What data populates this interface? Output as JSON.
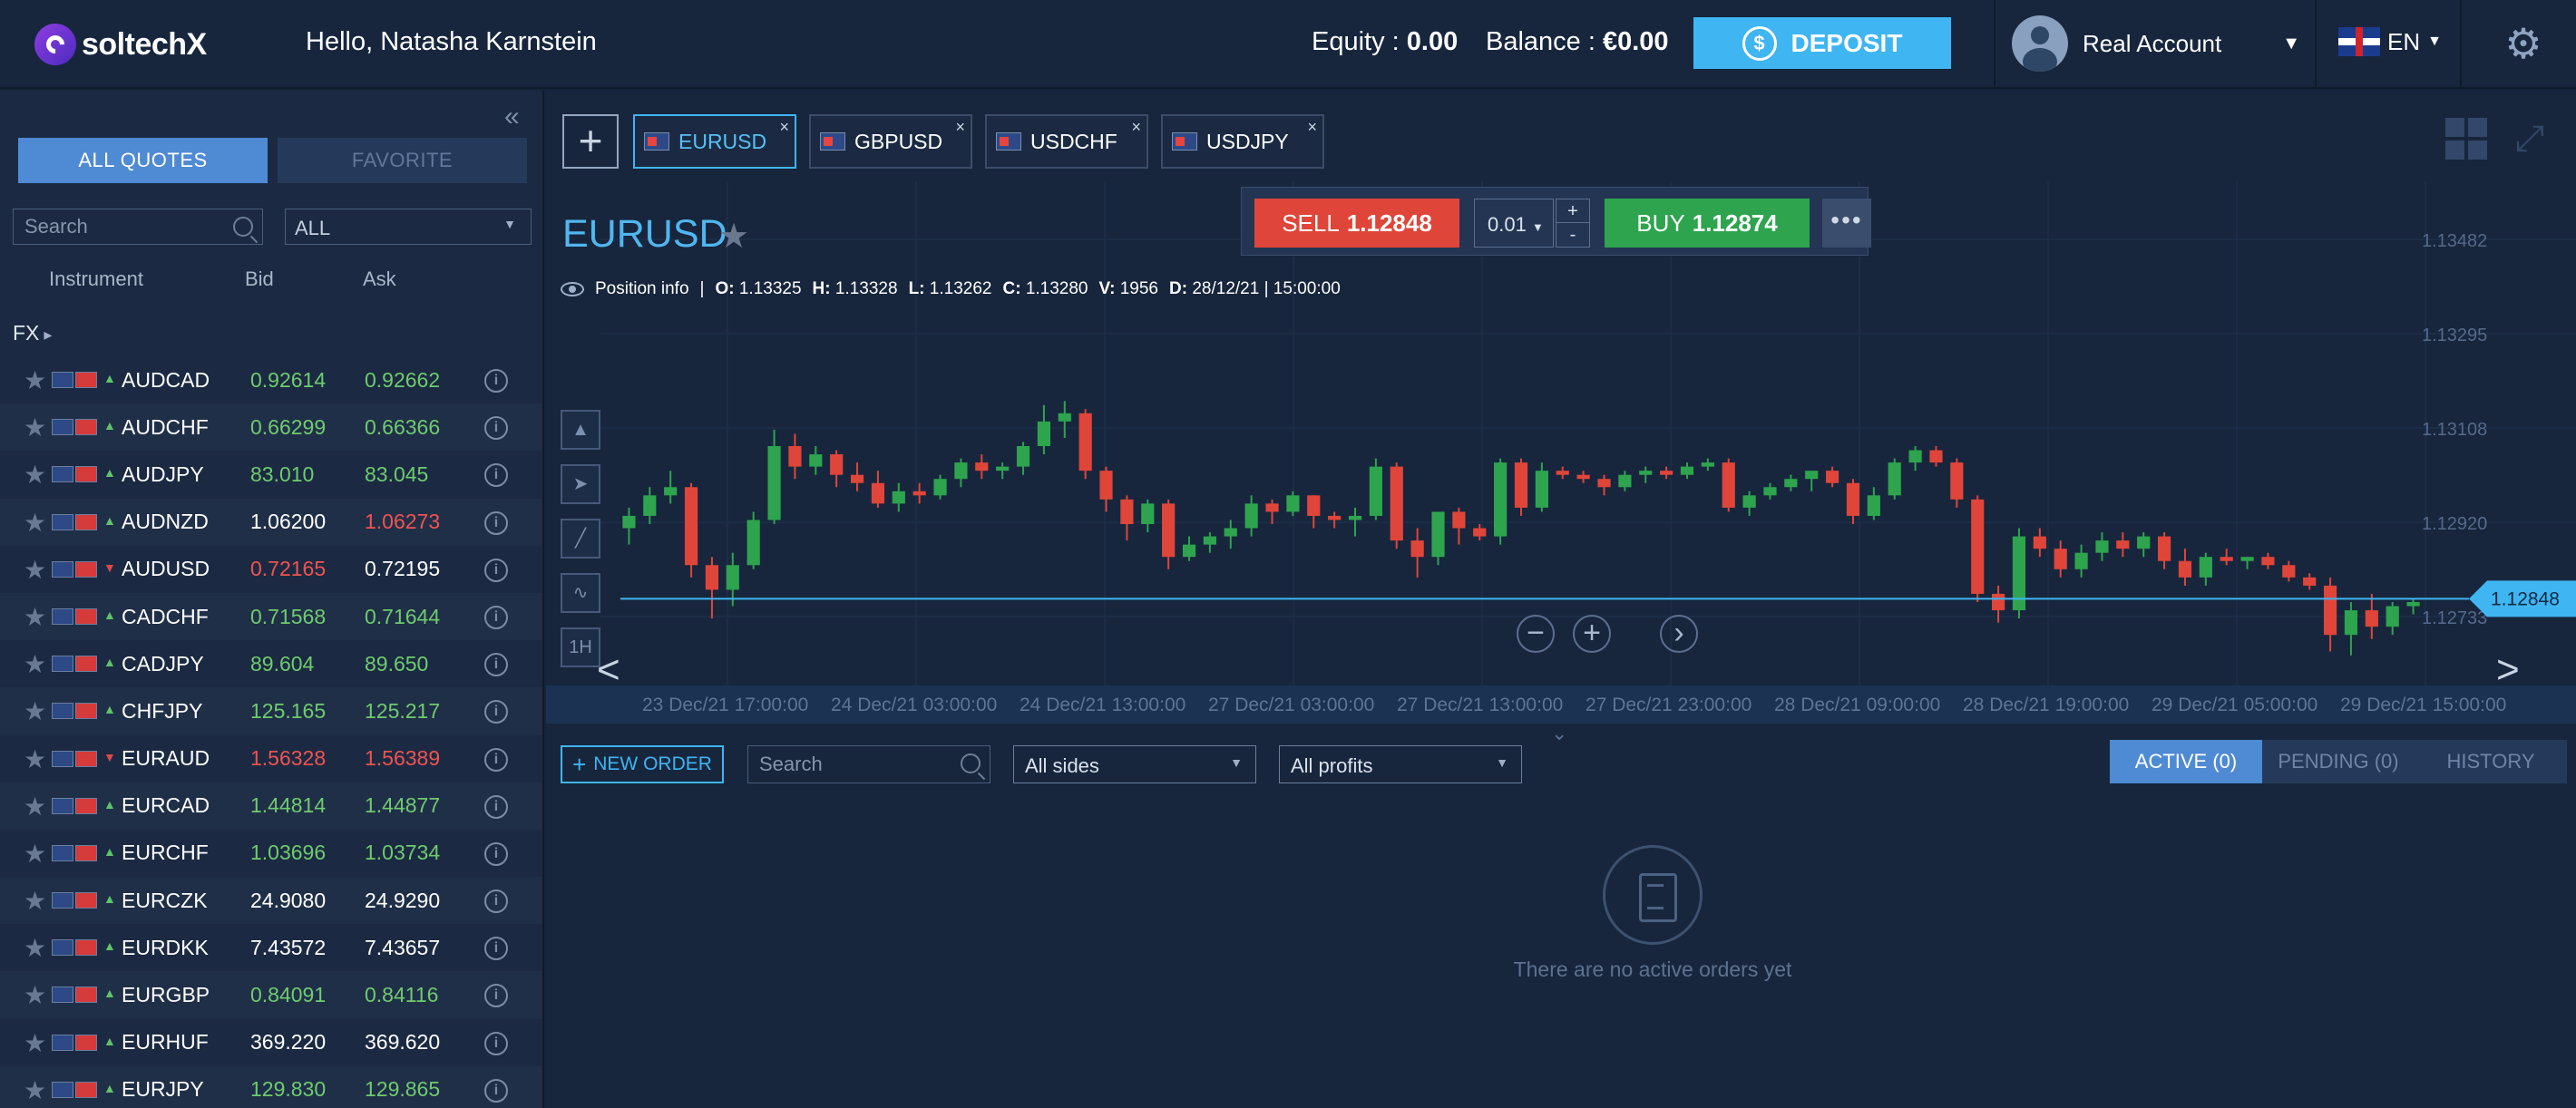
{
  "header": {
    "brand": "soltechX",
    "greeting": "Hello, Natasha Karnstein",
    "equity_label": "Equity :",
    "equity_value": "0.00",
    "balance_label": "Balance :",
    "balance_value": "€0.00",
    "deposit_label": "DEPOSIT",
    "deposit_coin": "$",
    "account_label": "Real Account",
    "language": "EN"
  },
  "sidebar": {
    "tab_all": "ALL QUOTES",
    "tab_favorite": "FAVORITE",
    "search_placeholder": "Search",
    "filter_value": "ALL",
    "col_instrument": "Instrument",
    "col_bid": "Bid",
    "col_ask": "Ask",
    "group": "FX",
    "quotes": [
      {
        "symbol": "AUDCAD",
        "bid": "0.92614",
        "ask": "0.92662",
        "dir": "up",
        "bid_color": "up",
        "ask_color": "up"
      },
      {
        "symbol": "AUDCHF",
        "bid": "0.66299",
        "ask": "0.66366",
        "dir": "up",
        "bid_color": "up",
        "ask_color": "up"
      },
      {
        "symbol": "AUDJPY",
        "bid": "83.010",
        "ask": "83.045",
        "dir": "up",
        "bid_color": "up",
        "ask_color": "up"
      },
      {
        "symbol": "AUDNZD",
        "bid": "1.06200",
        "ask": "1.06273",
        "dir": "up",
        "bid_color": "nt",
        "ask_color": "dn"
      },
      {
        "symbol": "AUDUSD",
        "bid": "0.72165",
        "ask": "0.72195",
        "dir": "down",
        "bid_color": "dn",
        "ask_color": "nt"
      },
      {
        "symbol": "CADCHF",
        "bid": "0.71568",
        "ask": "0.71644",
        "dir": "up",
        "bid_color": "up",
        "ask_color": "up"
      },
      {
        "symbol": "CADJPY",
        "bid": "89.604",
        "ask": "89.650",
        "dir": "up",
        "bid_color": "up",
        "ask_color": "up"
      },
      {
        "symbol": "CHFJPY",
        "bid": "125.165",
        "ask": "125.217",
        "dir": "up",
        "bid_color": "up",
        "ask_color": "up"
      },
      {
        "symbol": "EURAUD",
        "bid": "1.56328",
        "ask": "1.56389",
        "dir": "down",
        "bid_color": "dn",
        "ask_color": "dn"
      },
      {
        "symbol": "EURCAD",
        "bid": "1.44814",
        "ask": "1.44877",
        "dir": "up",
        "bid_color": "up",
        "ask_color": "up"
      },
      {
        "symbol": "EURCHF",
        "bid": "1.03696",
        "ask": "1.03734",
        "dir": "up",
        "bid_color": "up",
        "ask_color": "up"
      },
      {
        "symbol": "EURCZK",
        "bid": "24.9080",
        "ask": "24.9290",
        "dir": "up",
        "bid_color": "nt",
        "ask_color": "nt"
      },
      {
        "symbol": "EURDKK",
        "bid": "7.43572",
        "ask": "7.43657",
        "dir": "up",
        "bid_color": "nt",
        "ask_color": "nt"
      },
      {
        "symbol": "EURGBP",
        "bid": "0.84091",
        "ask": "0.84116",
        "dir": "up",
        "bid_color": "up",
        "ask_color": "up"
      },
      {
        "symbol": "EURHUF",
        "bid": "369.220",
        "ask": "369.620",
        "dir": "up",
        "bid_color": "nt",
        "ask_color": "nt"
      },
      {
        "symbol": "EURJPY",
        "bid": "129.830",
        "ask": "129.865",
        "dir": "up",
        "bid_color": "up",
        "ask_color": "up"
      }
    ]
  },
  "tabs": [
    {
      "label": "EURUSD",
      "active": true
    },
    {
      "label": "GBPUSD",
      "active": false
    },
    {
      "label": "USDCHF",
      "active": false
    },
    {
      "label": "USDJPY",
      "active": false
    }
  ],
  "chart": {
    "symbol": "EURUSD",
    "sell_label": "SELL",
    "sell_price": "1.12848",
    "lot": "0.01",
    "buy_label": "BUY",
    "buy_price": "1.12874",
    "position_info": "Position info",
    "ohlc": {
      "o": "1.13325",
      "h": "1.13328",
      "l": "1.13262",
      "c": "1.13280",
      "v": "1956",
      "d": "28/12/21 | 15:00:00"
    },
    "price_labels": [
      "1.13482",
      "1.13295",
      "1.13108",
      "1.12920",
      "1.12733"
    ],
    "current_price": "1.12848",
    "time_labels": [
      "23 Dec/21 17:00:00",
      "24 Dec/21 03:00:00",
      "24 Dec/21 13:00:00",
      "27 Dec/21 03:00:00",
      "27 Dec/21 13:00:00",
      "27 Dec/21 23:00:00",
      "28 Dec/21 09:00:00",
      "28 Dec/21 19:00:00",
      "29 Dec/21 05:00:00",
      "29 Dec/21 15:00:00"
    ],
    "tools": [
      "1H"
    ],
    "colors": {
      "up": "#2ea44f",
      "down": "#e0453a",
      "price_line": "#3fb5f2"
    }
  },
  "chart_data": {
    "type": "candlestick",
    "ylim": [
      1.1265,
      1.136
    ],
    "current_price": 1.12848,
    "candles": [
      [
        1.1302,
        1.1307,
        1.1298,
        1.1305
      ],
      [
        1.1305,
        1.1312,
        1.1303,
        1.131
      ],
      [
        1.131,
        1.1316,
        1.1308,
        1.1312
      ],
      [
        1.1312,
        1.1313,
        1.129,
        1.1293
      ],
      [
        1.1293,
        1.1295,
        1.128,
        1.1287
      ],
      [
        1.1287,
        1.1296,
        1.1283,
        1.1293
      ],
      [
        1.1293,
        1.1306,
        1.1292,
        1.1304
      ],
      [
        1.1304,
        1.1326,
        1.1303,
        1.1322
      ],
      [
        1.1322,
        1.1325,
        1.1314,
        1.1317
      ],
      [
        1.1317,
        1.1322,
        1.1315,
        1.132
      ],
      [
        1.132,
        1.1321,
        1.1312,
        1.1315
      ],
      [
        1.1315,
        1.1318,
        1.1311,
        1.1313
      ],
      [
        1.1313,
        1.1316,
        1.1307,
        1.1308
      ],
      [
        1.1308,
        1.1313,
        1.1306,
        1.1311
      ],
      [
        1.1311,
        1.1313,
        1.1308,
        1.131
      ],
      [
        1.131,
        1.1315,
        1.1309,
        1.1314
      ],
      [
        1.1314,
        1.1319,
        1.1312,
        1.1318
      ],
      [
        1.1318,
        1.132,
        1.1314,
        1.1316
      ],
      [
        1.1316,
        1.1318,
        1.1314,
        1.1317
      ],
      [
        1.1317,
        1.1323,
        1.1315,
        1.1322
      ],
      [
        1.1322,
        1.1332,
        1.132,
        1.1328
      ],
      [
        1.1328,
        1.1333,
        1.1324,
        1.133
      ],
      [
        1.133,
        1.1331,
        1.1314,
        1.1316
      ],
      [
        1.1316,
        1.1317,
        1.1306,
        1.1309
      ],
      [
        1.1309,
        1.131,
        1.1299,
        1.1303
      ],
      [
        1.1303,
        1.1309,
        1.1301,
        1.1308
      ],
      [
        1.1308,
        1.1309,
        1.1292,
        1.1295
      ],
      [
        1.1295,
        1.13,
        1.1294,
        1.1298
      ],
      [
        1.1298,
        1.1301,
        1.1296,
        1.13
      ],
      [
        1.13,
        1.1304,
        1.1297,
        1.1302
      ],
      [
        1.1302,
        1.131,
        1.13,
        1.1308
      ],
      [
        1.1308,
        1.1309,
        1.1303,
        1.1306
      ],
      [
        1.1306,
        1.1311,
        1.1305,
        1.131
      ],
      [
        1.131,
        1.131,
        1.1302,
        1.1305
      ],
      [
        1.1305,
        1.1306,
        1.1302,
        1.1304
      ],
      [
        1.1304,
        1.1307,
        1.13,
        1.1305
      ],
      [
        1.1305,
        1.1319,
        1.1304,
        1.1317
      ],
      [
        1.1317,
        1.1318,
        1.1297,
        1.1299
      ],
      [
        1.1299,
        1.1302,
        1.129,
        1.1295
      ],
      [
        1.1295,
        1.1303,
        1.1293,
        1.1306
      ],
      [
        1.1306,
        1.1307,
        1.1298,
        1.1302
      ],
      [
        1.1302,
        1.1303,
        1.1299,
        1.13
      ],
      [
        1.13,
        1.1319,
        1.1298,
        1.1318
      ],
      [
        1.1318,
        1.1319,
        1.1305,
        1.1307
      ],
      [
        1.1307,
        1.1318,
        1.1306,
        1.1316
      ],
      [
        1.1316,
        1.1317,
        1.1314,
        1.1315
      ],
      [
        1.1315,
        1.1316,
        1.1313,
        1.1314
      ],
      [
        1.1314,
        1.1315,
        1.131,
        1.1312
      ],
      [
        1.1312,
        1.1316,
        1.1311,
        1.1315
      ],
      [
        1.1315,
        1.1317,
        1.1313,
        1.1316
      ],
      [
        1.1316,
        1.1317,
        1.1314,
        1.1315
      ],
      [
        1.1315,
        1.1318,
        1.1314,
        1.1317
      ],
      [
        1.1317,
        1.1319,
        1.1316,
        1.1318
      ],
      [
        1.1318,
        1.1319,
        1.1306,
        1.1307
      ],
      [
        1.1307,
        1.1311,
        1.1305,
        1.131
      ],
      [
        1.131,
        1.1313,
        1.1309,
        1.1312
      ],
      [
        1.1312,
        1.1315,
        1.1311,
        1.1314
      ],
      [
        1.1314,
        1.1315,
        1.1311,
        1.1316
      ],
      [
        1.1316,
        1.1317,
        1.1312,
        1.1313
      ],
      [
        1.1313,
        1.1314,
        1.1303,
        1.1305
      ],
      [
        1.1305,
        1.1312,
        1.1304,
        1.131
      ],
      [
        1.131,
        1.1319,
        1.1309,
        1.1318
      ],
      [
        1.1318,
        1.1322,
        1.1316,
        1.1321
      ],
      [
        1.1321,
        1.1322,
        1.1317,
        1.1318
      ],
      [
        1.1318,
        1.1319,
        1.1307,
        1.1309
      ],
      [
        1.1309,
        1.131,
        1.1284,
        1.1286
      ],
      [
        1.1286,
        1.1288,
        1.1279,
        1.1282
      ],
      [
        1.1282,
        1.1302,
        1.128,
        1.13
      ],
      [
        1.13,
        1.1302,
        1.1295,
        1.1297
      ],
      [
        1.1297,
        1.1299,
        1.129,
        1.1292
      ],
      [
        1.1292,
        1.1298,
        1.129,
        1.1296
      ],
      [
        1.1296,
        1.1301,
        1.1294,
        1.1299
      ],
      [
        1.1299,
        1.1301,
        1.1295,
        1.1297
      ],
      [
        1.1297,
        1.1301,
        1.1295,
        1.13
      ],
      [
        1.13,
        1.1301,
        1.1292,
        1.1294
      ],
      [
        1.1294,
        1.1297,
        1.1288,
        1.129
      ],
      [
        1.129,
        1.1296,
        1.1288,
        1.1295
      ],
      [
        1.1295,
        1.1297,
        1.1293,
        1.1294
      ],
      [
        1.1294,
        1.1295,
        1.1292,
        1.1295
      ],
      [
        1.1295,
        1.1296,
        1.1292,
        1.1293
      ],
      [
        1.1293,
        1.1294,
        1.1289,
        1.129
      ],
      [
        1.129,
        1.1291,
        1.1287,
        1.1288
      ],
      [
        1.1288,
        1.129,
        1.1272,
        1.1276
      ],
      [
        1.1276,
        1.1284,
        1.1271,
        1.1282
      ],
      [
        1.1282,
        1.1286,
        1.1275,
        1.1278
      ],
      [
        1.1278,
        1.1284,
        1.1276,
        1.1283
      ],
      [
        1.1283,
        1.1285,
        1.1281,
        1.1284
      ]
    ]
  },
  "orders": {
    "new_order": "NEW ORDER",
    "search_placeholder": "Search",
    "sides": "All sides",
    "profits": "All profits",
    "tab_active": "ACTIVE (0)",
    "tab_pending": "PENDING (0)",
    "tab_history": "HISTORY",
    "empty_message": "There are no active orders yet"
  }
}
